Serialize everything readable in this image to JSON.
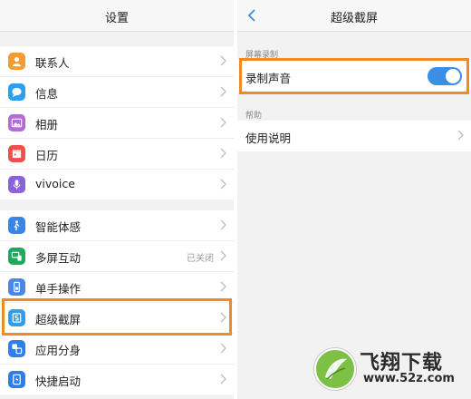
{
  "left_screen": {
    "title": "设置",
    "group1": [
      {
        "label": "联系人",
        "icon": "contacts-icon",
        "color": "#f39c34"
      },
      {
        "label": "信息",
        "icon": "message-icon",
        "color": "#2d9ef0"
      },
      {
        "label": "相册",
        "icon": "gallery-icon",
        "color": "#b36bd6"
      },
      {
        "label": "日历",
        "icon": "calendar-icon",
        "color": "#ef4f4f"
      },
      {
        "label": "vivoice",
        "icon": "microphone-icon",
        "color": "#8b63d8"
      }
    ],
    "group2": [
      {
        "label": "智能体感",
        "icon": "motion-icon",
        "color": "#3a86e8",
        "value": ""
      },
      {
        "label": "多屏互动",
        "icon": "multiscreen-icon",
        "color": "#1cab5e",
        "value": "已关闭"
      },
      {
        "label": "单手操作",
        "icon": "one-hand-icon",
        "color": "#4b86e8",
        "value": ""
      },
      {
        "label": "超级截屏",
        "icon": "screenshot-icon",
        "color": "#2f9df0",
        "value": ""
      },
      {
        "label": "应用分身",
        "icon": "app-clone-icon",
        "color": "#2f7fe8",
        "value": ""
      },
      {
        "label": "快捷启动",
        "icon": "quick-launch-icon",
        "color": "#2d7ee6",
        "value": ""
      }
    ]
  },
  "right_screen": {
    "title": "超级截屏",
    "section1_label": "屏幕录制",
    "record_sound_label": "录制声音",
    "record_sound_on": true,
    "section2_label": "帮助",
    "help_item_label": "使用说明"
  },
  "watermark": {
    "title": "飞翔下载",
    "url": "www.52z.com"
  },
  "colors": {
    "highlight": "#f08a24",
    "toggle_on": "#3a8ee6",
    "background": "#f2f2f2"
  }
}
